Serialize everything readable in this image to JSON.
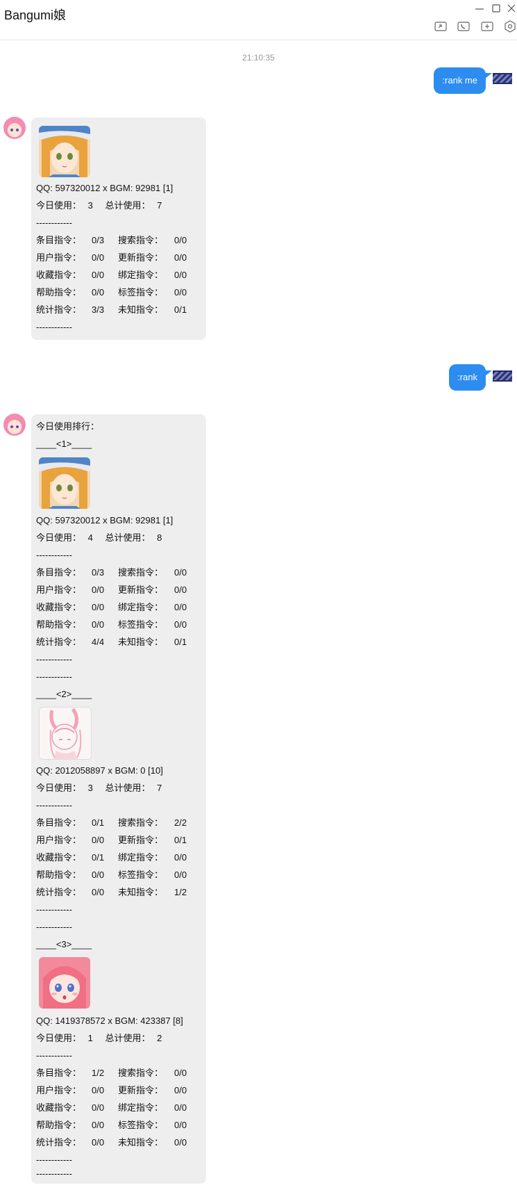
{
  "window": {
    "title": "Bangumi娘",
    "controls": [
      "minimize-icon",
      "maximize-icon",
      "close-icon"
    ],
    "toolbar_icons": [
      "screen-share-icon",
      "phone-icon",
      "add-member-icon",
      "settings-icon"
    ]
  },
  "chat": {
    "timestamp": "21:10:35",
    "messages": [
      {
        "id": "m1",
        "from": "user",
        "text": ":rank me"
      },
      {
        "id": "m2",
        "from": "bot",
        "sections": [
          {
            "picture": "avatar-blonde-hat",
            "qq_line": "QQ: 597320012 x BGM: 92981  [1]",
            "today_label": "今日使用：",
            "today_value": "3",
            "total_label": "总计使用：",
            "total_value": "7",
            "sep": "------------",
            "stats": [
              {
                "l1": "条目指令：",
                "v1": "0/3",
                "l2": "搜索指令：",
                "v2": "0/0"
              },
              {
                "l1": "用户指令：",
                "v1": "0/0",
                "l2": "更新指令：",
                "v2": "0/0"
              },
              {
                "l1": "收藏指令：",
                "v1": "0/0",
                "l2": "绑定指令：",
                "v2": "0/0"
              },
              {
                "l1": "帮助指令：",
                "v1": "0/0",
                "l2": "标签指令：",
                "v2": "0/0"
              },
              {
                "l1": "统计指令：",
                "v1": "3/3",
                "l2": "未知指令：",
                "v2": "0/1"
              }
            ],
            "end_sep": "------------"
          }
        ]
      },
      {
        "id": "m3",
        "from": "user",
        "text": ":rank"
      },
      {
        "id": "m4",
        "from": "bot",
        "heading": "今日使用排行：",
        "sections": [
          {
            "rank": "____<1>____",
            "picture": "avatar-blonde-hat",
            "qq_line": "QQ: 597320012 x BGM: 92981  [1]",
            "today_label": "今日使用：",
            "today_value": "4",
            "total_label": "总计使用：",
            "total_value": "8",
            "sep": "------------",
            "stats": [
              {
                "l1": "条目指令：",
                "v1": "0/3",
                "l2": "搜索指令：",
                "v2": "0/0"
              },
              {
                "l1": "用户指令：",
                "v1": "0/0",
                "l2": "更新指令：",
                "v2": "0/0"
              },
              {
                "l1": "收藏指令：",
                "v1": "0/0",
                "l2": "绑定指令：",
                "v2": "0/0"
              },
              {
                "l1": "帮助指令：",
                "v1": "0/0",
                "l2": "标签指令：",
                "v2": "0/0"
              },
              {
                "l1": "统计指令：",
                "v1": "4/4",
                "l2": "未知指令：",
                "v2": "0/1"
              }
            ],
            "end_sep": "------------",
            "end_sep2": "------------"
          },
          {
            "rank": "____<2>____",
            "picture": "avatar-pink-sketch",
            "qq_line": "QQ: 2012058897 x BGM: 0  [10]",
            "today_label": "今日使用：",
            "today_value": "3",
            "total_label": "总计使用：",
            "total_value": "7",
            "sep": "------------",
            "stats": [
              {
                "l1": "条目指令：",
                "v1": "0/1",
                "l2": "搜索指令：",
                "v2": "2/2"
              },
              {
                "l1": "用户指令：",
                "v1": "0/0",
                "l2": "更新指令：",
                "v2": "0/1"
              },
              {
                "l1": "收藏指令：",
                "v1": "0/1",
                "l2": "绑定指令：",
                "v2": "0/0"
              },
              {
                "l1": "帮助指令：",
                "v1": "0/0",
                "l2": "标签指令：",
                "v2": "0/0"
              },
              {
                "l1": "统计指令：",
                "v1": "0/0",
                "l2": "未知指令：",
                "v2": "1/2"
              }
            ],
            "end_sep": "------------",
            "end_sep2": "------------"
          },
          {
            "rank": "____<3>____",
            "picture": "avatar-pink-girl",
            "qq_line": "QQ: 1419378572 x BGM: 423387  [8]",
            "today_label": "今日使用：",
            "today_value": "1",
            "total_label": "总计使用：",
            "total_value": "2",
            "sep": "------------",
            "stats": [
              {
                "l1": "条目指令：",
                "v1": "1/2",
                "l2": "搜索指令：",
                "v2": "0/0"
              },
              {
                "l1": "用户指令：",
                "v1": "0/0",
                "l2": "更新指令：",
                "v2": "0/0"
              },
              {
                "l1": "收藏指令：",
                "v1": "0/0",
                "l2": "绑定指令：",
                "v2": "0/0"
              },
              {
                "l1": "帮助指令：",
                "v1": "0/0",
                "l2": "标签指令：",
                "v2": "0/0"
              },
              {
                "l1": "统计指令：",
                "v1": "0/0",
                "l2": "未知指令：",
                "v2": "0/0"
              }
            ],
            "end_sep": "------------",
            "end_sep2": "------------"
          }
        ]
      }
    ]
  },
  "colors": {
    "outgoing_bubble": "#2d8cf0",
    "incoming_bubble": "#eeeeee",
    "timestamp": "#999999"
  }
}
